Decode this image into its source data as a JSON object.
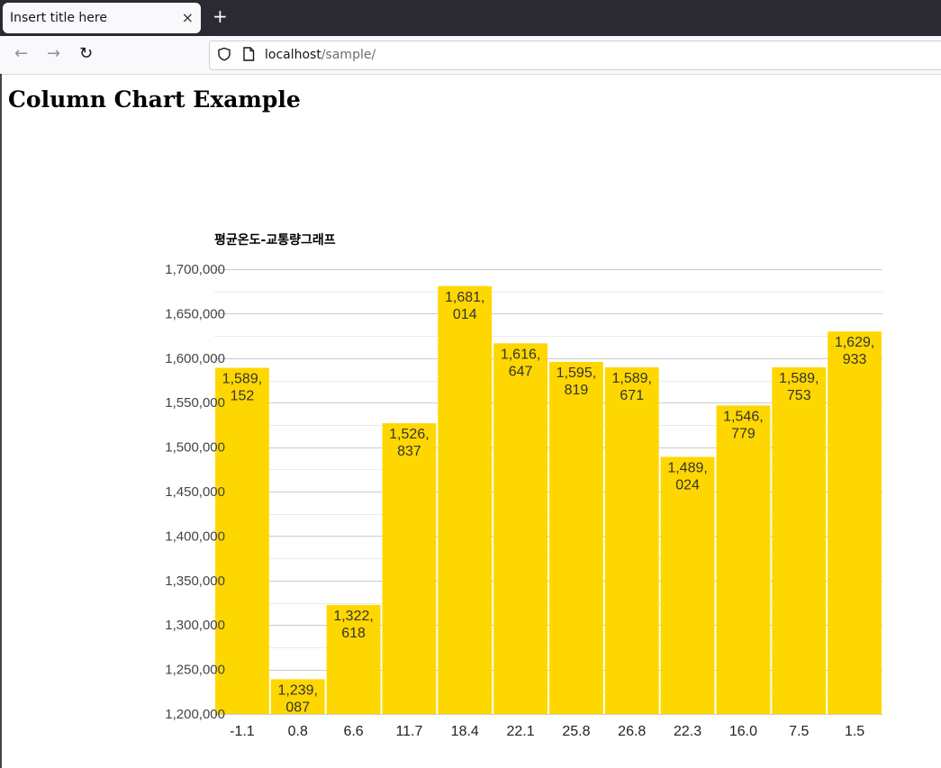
{
  "browser": {
    "tab_title": "Insert title here",
    "tab_close": "×",
    "new_tab": "+",
    "back": "←",
    "forward": "→",
    "reload": "↻",
    "url_host": "localhost",
    "url_path": "/sample/"
  },
  "page": {
    "heading": "Column Chart Example"
  },
  "chart_data": {
    "type": "bar",
    "title": "평균온도-교통량그래프",
    "xlabel": "",
    "ylabel": "",
    "categories": [
      "-1.1",
      "0.8",
      "6.6",
      "11.7",
      "18.4",
      "22.1",
      "25.8",
      "26.8",
      "22.3",
      "16.0",
      "7.5",
      "1.5"
    ],
    "values": [
      1589152,
      1239087,
      1322618,
      1526837,
      1681014,
      1616647,
      1595819,
      1589671,
      1489024,
      1546779,
      1589753,
      1629933
    ],
    "ylim": [
      1200000,
      1700000
    ],
    "yticks": [
      "1,200,000",
      "1,250,000",
      "1,300,000",
      "1,350,000",
      "1,400,000",
      "1,450,000",
      "1,500,000",
      "1,550,000",
      "1,600,000",
      "1,650,000",
      "1,700,000"
    ],
    "data_labels": [
      [
        "1,589,",
        "152"
      ],
      [
        "1,239,",
        "087"
      ],
      [
        "1,322,",
        "618"
      ],
      [
        "1,526,",
        "837"
      ],
      [
        "1,681,",
        "014"
      ],
      [
        "1,616,",
        "647"
      ],
      [
        "1,595,",
        "819"
      ],
      [
        "1,589,",
        "671"
      ],
      [
        "1,489,",
        "024"
      ],
      [
        "1,546,",
        "779"
      ],
      [
        "1,589,",
        "753"
      ],
      [
        "1,629,",
        "933"
      ]
    ],
    "bar_color": "#ffd700",
    "grid": true,
    "legend": "none"
  }
}
